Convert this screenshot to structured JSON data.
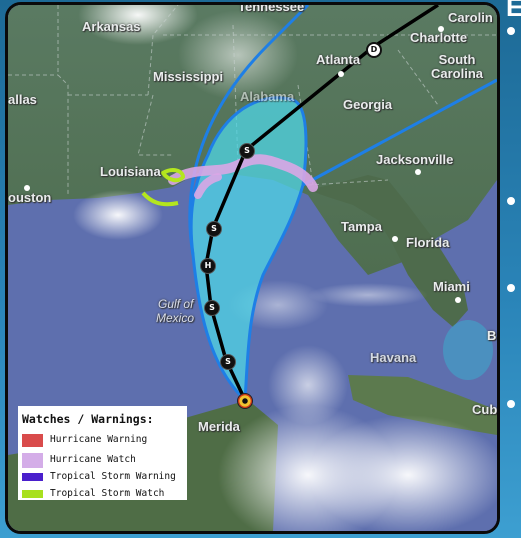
{
  "slide": {
    "title_partial": "E",
    "bullet_count": 4
  },
  "map": {
    "places": {
      "arkansas": "Arkansas",
      "tennessee": "Tennessee",
      "mississippi": "Mississippi",
      "dallas": "allas",
      "alabama": "Alabama",
      "atlanta": "Atlanta",
      "georgia": "Georgia",
      "charlotte": "Charlotte",
      "north_carolina": "Carolin",
      "south_carolina": "South Carolina",
      "louisiana": "Louisiana",
      "houston": "ouston",
      "jacksonville": "Jacksonville",
      "tampa": "Tampa",
      "florida": "Florida",
      "miami": "Miami",
      "gulf_of_mexico_1": "Gulf of",
      "gulf_of_mexico_2": "Mexico",
      "havana": "Havana",
      "merida": "Merida",
      "cuba": "Cub",
      "bahamas": "B"
    },
    "track_markers": [
      {
        "label": "D",
        "type": "depression"
      },
      {
        "label": "S",
        "type": "storm"
      },
      {
        "label": "S",
        "type": "storm"
      },
      {
        "label": "H",
        "type": "hurricane"
      },
      {
        "label": "S",
        "type": "storm"
      },
      {
        "label": "S",
        "type": "storm"
      }
    ],
    "colors": {
      "cone_fill": "#4fd6e6",
      "cone_outline": "#1e7fe6",
      "track_line": "#000000",
      "hurricane_watch": "#d9a6e6",
      "tropical_storm_watch": "#b4e61e"
    }
  },
  "legend": {
    "title": "Watches / Warnings:",
    "items": [
      {
        "label": "Hurricane Warning",
        "color": "#d94b4b"
      },
      {
        "label": "Hurricane Watch",
        "color": "#d4ade8"
      },
      {
        "label": "Tropical Storm Warning",
        "color": "#4a1fcc"
      },
      {
        "label": "Tropical Storm Watch",
        "color": "#a8e01e"
      }
    ]
  }
}
